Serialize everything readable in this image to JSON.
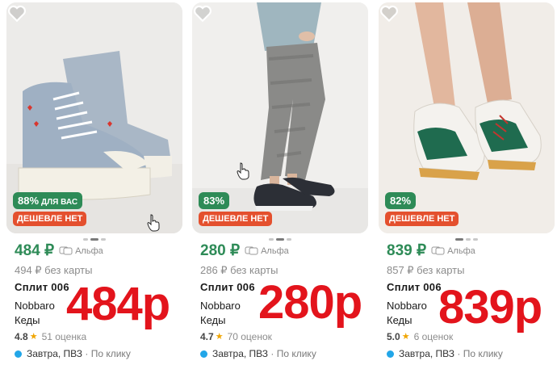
{
  "colors": {
    "price_green": "#2e8b57",
    "cheaper_red": "#e4502e",
    "overlay_red": "#e3141c",
    "delivery_dot": "#22a6e8"
  },
  "products": [
    {
      "discount": "88%",
      "discount_sub": "ДЛЯ ВАС",
      "cheaper": "ДЕШЕВЛЕ НЕТ",
      "price": "484 ₽",
      "bank": "Альфа",
      "old_price": "494 ₽ без карты",
      "split": "Сплит 006",
      "brand": "Nobbaro",
      "type": "Кеды",
      "rating": "4.8",
      "reviews": "51 оценка",
      "delivery": "Завтра, ПВЗ",
      "delivery_extra": "· По клику",
      "overlay": "484р"
    },
    {
      "discount": "83%",
      "discount_sub": "",
      "cheaper": "ДЕШЕВЛЕ НЕТ",
      "price": "280 ₽",
      "bank": "Альфа",
      "old_price": "286 ₽ без карты",
      "split": "Сплит 006",
      "brand": "Nobbaro",
      "type": "Кеды",
      "rating": "4.7",
      "reviews": "70 оценок",
      "delivery": "Завтра, ПВЗ",
      "delivery_extra": "· По клику",
      "overlay": "280р"
    },
    {
      "discount": "82%",
      "discount_sub": "",
      "cheaper": "ДЕШЕВЛЕ НЕТ",
      "price": "839 ₽",
      "bank": "Альфа",
      "old_price": "857 ₽ без карты",
      "split": "Сплит 006",
      "brand": "Nobbaro",
      "type": "Кеды",
      "rating": "5.0",
      "reviews": "6 оценок",
      "delivery": "Завтра, ПВЗ",
      "delivery_extra": "· По клику",
      "overlay": "839р"
    }
  ]
}
